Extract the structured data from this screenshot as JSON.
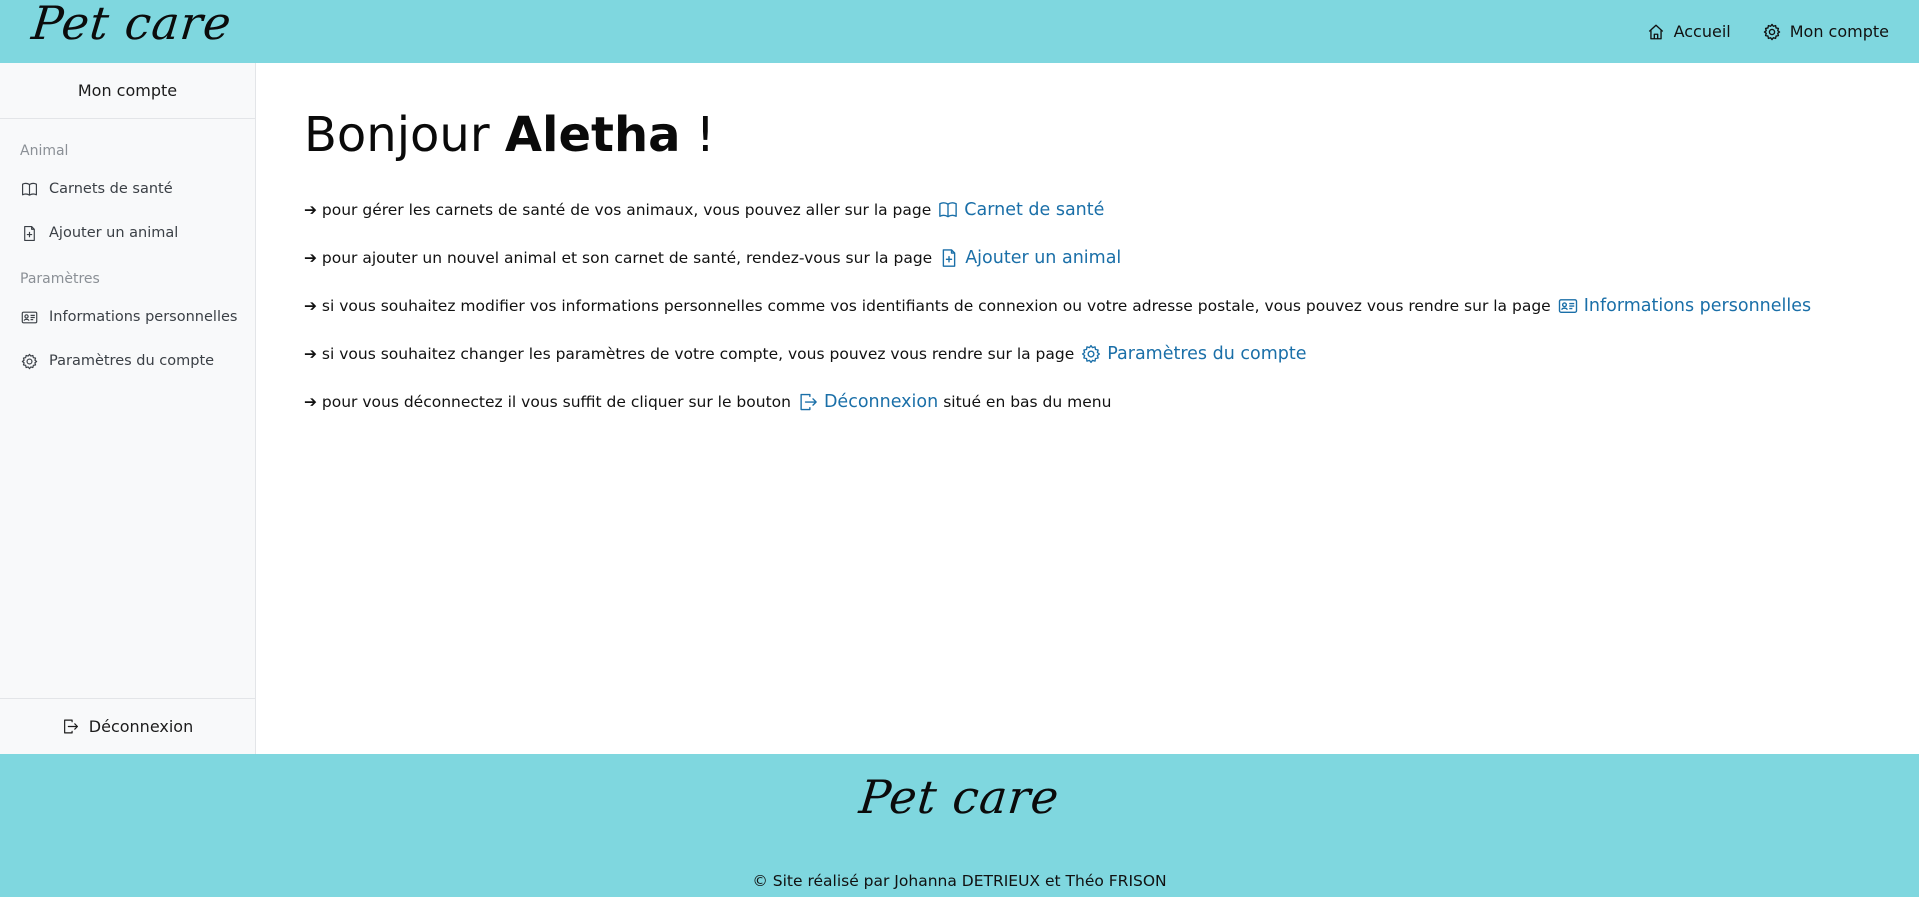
{
  "colors": {
    "brand": "#7fd7df",
    "link": "#1a6fa8",
    "sidebar_bg": "#f8f9fa"
  },
  "header": {
    "logo": "Pet care",
    "nav": {
      "home": {
        "label": "Accueil",
        "icon": "house-icon"
      },
      "account": {
        "label": "Mon compte",
        "icon": "gear-icon"
      }
    }
  },
  "sidebar": {
    "title": "Mon compte",
    "sections": [
      {
        "label": "Animal",
        "items": [
          {
            "label": "Carnets de santé",
            "icon": "open-book-icon"
          },
          {
            "label": "Ajouter un animal",
            "icon": "file-plus-icon"
          }
        ]
      },
      {
        "label": "Paramètres",
        "items": [
          {
            "label": "Informations personnelles",
            "icon": "id-card-icon"
          },
          {
            "label": "Paramètres du compte",
            "icon": "gear-icon"
          }
        ]
      }
    ],
    "logout": {
      "label": "Déconnexion",
      "icon": "logout-icon"
    }
  },
  "main": {
    "greeting_prefix": "Bonjour",
    "user_name": "Aletha",
    "greeting_suffix": "!",
    "lines": [
      {
        "text": "➔ pour gérer les carnets de santé de vos animaux, vous pouvez aller sur la page",
        "link": "Carnet de santé",
        "icon": "open-book-icon",
        "after": ""
      },
      {
        "text": "➔ pour ajouter un nouvel animal et son carnet de santé, rendez-vous sur la page",
        "link": "Ajouter un animal",
        "icon": "file-plus-icon",
        "after": ""
      },
      {
        "text": "➔ si vous souhaitez modifier vos informations personnelles comme vos identifiants de connexion ou votre adresse postale, vous pouvez vous rendre sur la page",
        "link": "Informations personnelles",
        "icon": "id-card-icon",
        "after": ""
      },
      {
        "text": "➔ si vous souhaitez changer les paramètres de votre compte, vous pouvez vous rendre sur la page",
        "link": "Paramètres du compte",
        "icon": "gear-icon",
        "after": ""
      },
      {
        "text": "➔ pour vous déconnectez il vous suffit de cliquer sur le bouton",
        "link": "Déconnexion",
        "icon": "logout-icon",
        "after": "situé en bas du menu"
      }
    ]
  },
  "footer": {
    "logo": "Pet care",
    "copyright": "© Site réalisé par Johanna DETRIEUX et Théo FRISON"
  }
}
